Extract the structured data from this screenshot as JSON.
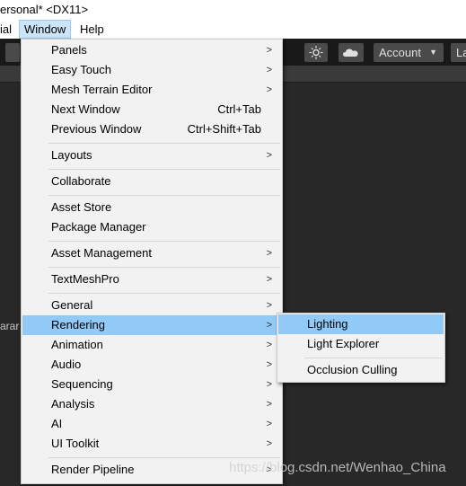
{
  "titlebar": {
    "text": "ersonal* <DX11>"
  },
  "menubar": {
    "items": [
      {
        "label": "ial"
      },
      {
        "label": "Window"
      },
      {
        "label": "Help"
      }
    ]
  },
  "toolbar": {
    "account_label": "Account",
    "layers_label": "La",
    "icons": [
      "settings-sparkle-icon",
      "cloud-icon"
    ]
  },
  "side_panel": {
    "partial_label": "arar"
  },
  "window_menu": {
    "items": [
      {
        "label": "Panels",
        "submenu": true
      },
      {
        "label": "Easy Touch",
        "submenu": true
      },
      {
        "label": "Mesh Terrain Editor",
        "submenu": true
      },
      {
        "label": "Next Window",
        "shortcut": "Ctrl+Tab"
      },
      {
        "label": "Previous Window",
        "shortcut": "Ctrl+Shift+Tab"
      },
      {
        "label": "Layouts",
        "submenu": true
      },
      {
        "label": "Collaborate"
      },
      {
        "label": "Asset Store"
      },
      {
        "label": "Package Manager"
      },
      {
        "label": "Asset Management",
        "submenu": true
      },
      {
        "label": "TextMeshPro",
        "submenu": true
      },
      {
        "label": "General",
        "submenu": true
      },
      {
        "label": "Rendering",
        "submenu": true,
        "highlighted": true
      },
      {
        "label": "Animation",
        "submenu": true
      },
      {
        "label": "Audio",
        "submenu": true
      },
      {
        "label": "Sequencing",
        "submenu": true
      },
      {
        "label": "Analysis",
        "submenu": true
      },
      {
        "label": "AI",
        "submenu": true
      },
      {
        "label": "UI Toolkit",
        "submenu": true
      },
      {
        "label": "Render Pipeline",
        "submenu": true
      }
    ]
  },
  "rendering_submenu": {
    "items": [
      {
        "label": "Lighting",
        "highlighted": true
      },
      {
        "label": "Light Explorer"
      },
      {
        "label": "Occlusion Culling"
      }
    ]
  },
  "watermark": {
    "text": "https://blog.csdn.net/Wenhao_China"
  },
  "colors": {
    "menu_bg": "#f2f2f2",
    "highlight": "#91c9f7",
    "editor_dark": "#282828"
  }
}
